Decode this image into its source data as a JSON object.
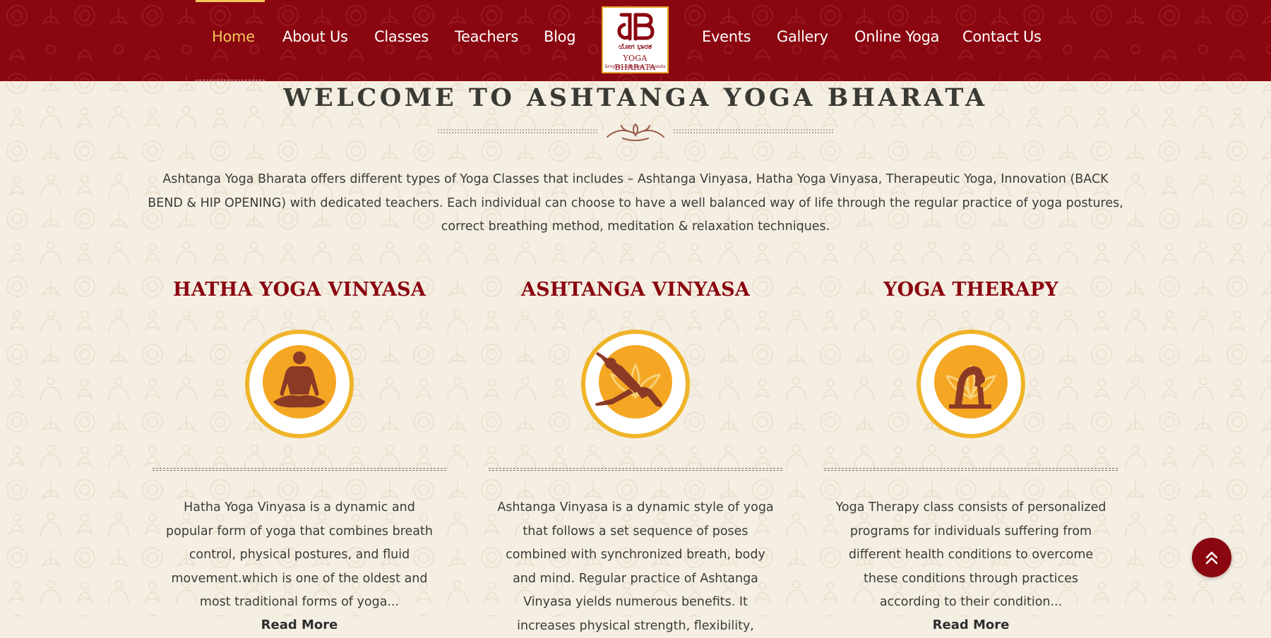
{
  "nav": {
    "left": [
      "Home",
      "About Us",
      "Classes",
      "Teachers",
      "Blog"
    ],
    "right": [
      "Events",
      "Gallery",
      "Online Yoga",
      "Contact Us"
    ],
    "active": "Home"
  },
  "logo": {
    "script": "ಯೋಗ ಭಾರತ",
    "name": "YOGA BHARATA",
    "tagline": "ārogya . abhyasa . ānanda"
  },
  "welcome": {
    "title": "WELCOME TO ASHTANGA YOGA BHARATA",
    "intro": "Ashtanga Yoga Bharata offers different types of Yoga Classes that includes – Ashtanga Vinyasa, Hatha Yoga Vinyasa, Therapeutic Yoga, Innovation (BACK BEND & HIP OPENING) with dedicated teachers. Each individual can choose to have a well balanced way of life through the regular practice of yoga postures, correct breathing method, meditation & relaxation techniques."
  },
  "classes": [
    {
      "title": "HATHA YOGA VINYASA",
      "icon": "meditation-pose-icon",
      "text": "Hatha Yoga Vinyasa is a dynamic and popular form of yoga that combines breath control, physical postures, and fluid movement.which is one of the oldest and most traditional forms of yoga...",
      "link": "Read More"
    },
    {
      "title": "ASHTANGA VINYASA",
      "icon": "lunge-pose-icon",
      "text": "Ashtanga Vinyasa is a dynamic style of yoga that follows a set sequence of poses combined with synchronized breath, body and mind. Regular practice of Ashtanga Vinyasa yields numerous benefits. It increases physical strength, flexibility,",
      "link": ""
    },
    {
      "title": "YOGA THERAPY",
      "icon": "camel-pose-icon",
      "text": "Yoga Therapy class consists of personalized programs for individuals suffering from different health conditions to overcome these conditions through practices according to their condition...",
      "link": "Read More"
    }
  ],
  "colors": {
    "brand_red": "#8a0610",
    "accent_gold": "#f3c75a",
    "icon_ring": "#f0b429",
    "background": "#f5efe3"
  },
  "scroll_top": {
    "icon": "double-chevron-up-icon"
  }
}
